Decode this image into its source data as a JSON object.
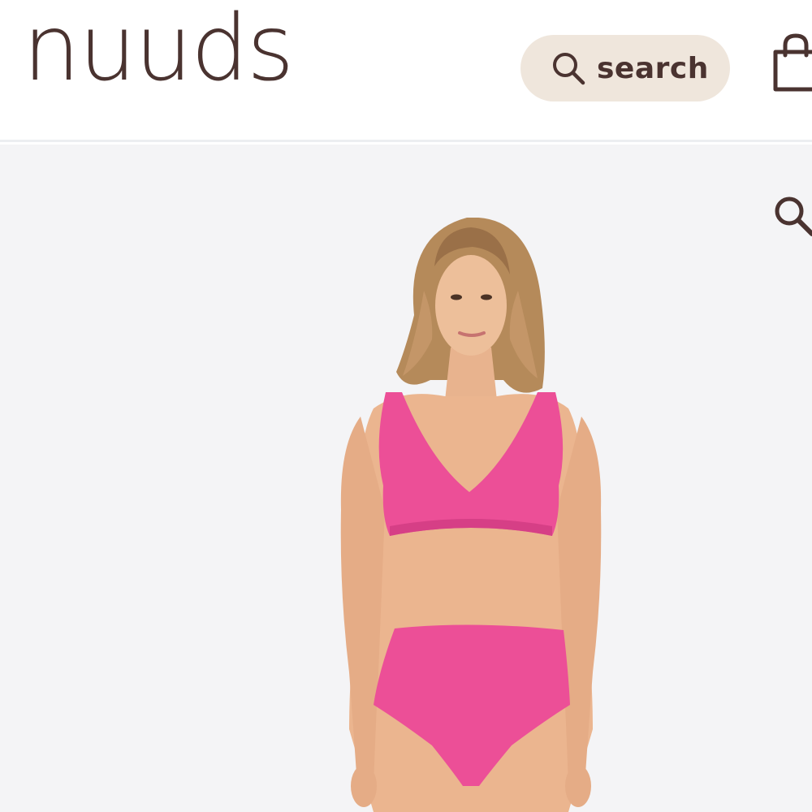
{
  "header": {
    "logo_text": "nuuds",
    "search": {
      "label": "search",
      "icon": "search-icon"
    },
    "cart": {
      "icon": "shopping-bag-icon"
    }
  },
  "gallery": {
    "zoom_icon": "zoom-icon",
    "product": {
      "image": "product-photo-pink-bikini"
    }
  },
  "colors": {
    "brand_text": "#4a3330",
    "search_pill_bg": "#efe6dc",
    "gallery_bg": "#f4f4f6",
    "product_pink": "#ec4f97"
  }
}
